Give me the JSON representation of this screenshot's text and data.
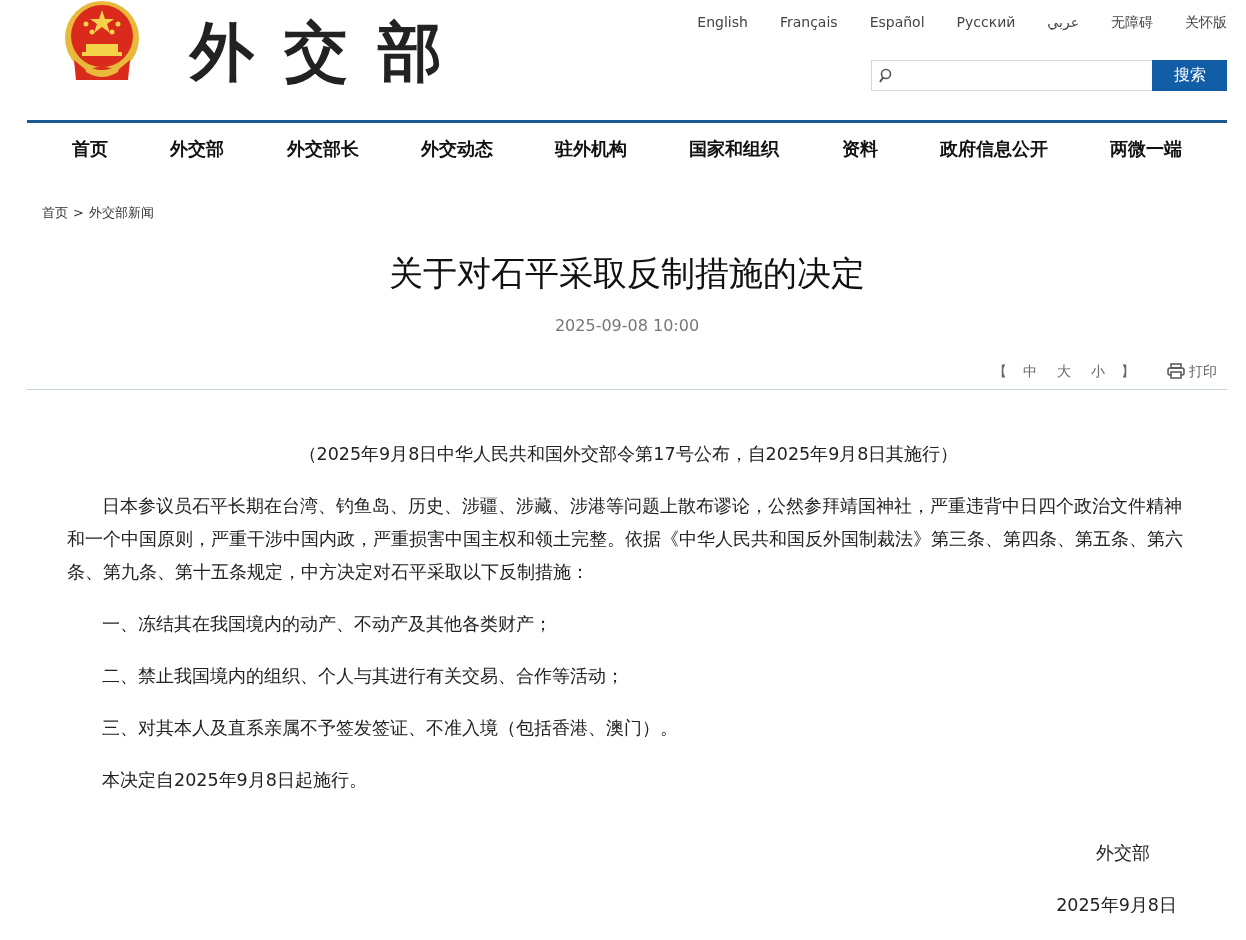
{
  "header": {
    "logo_text": "外交部",
    "languages": [
      "English",
      "Français",
      "Español",
      "Русский",
      "عربي",
      "无障碍",
      "关怀版"
    ],
    "search": {
      "button": "搜索"
    }
  },
  "nav": [
    {
      "label": "首页"
    },
    {
      "label": "外交部"
    },
    {
      "label": "外交部长"
    },
    {
      "label": "外交动态"
    },
    {
      "label": "驻外机构"
    },
    {
      "label": "国家和组织"
    },
    {
      "label": "资料"
    },
    {
      "label": "政府信息公开"
    },
    {
      "label": "两微一端"
    }
  ],
  "breadcrumb": [
    {
      "label": "首页"
    },
    {
      "label": "外交部新闻"
    }
  ],
  "breadcrumb_separator": ">",
  "article": {
    "title": "关于对石平采取反制措施的决定",
    "date": "2025-09-08 10:00",
    "tools": {
      "open": "【",
      "sizes": [
        "中",
        "大",
        "小"
      ],
      "close": "】",
      "print": "打印"
    },
    "paragraphs": [
      {
        "kind": "center",
        "text": "（2025年9月8日中华人民共和国外交部令第17号公布，自2025年9月8日其施行）"
      },
      {
        "kind": "indent",
        "text": "日本参议员石平长期在台湾、钓鱼岛、历史、涉疆、涉藏、涉港等问题上散布谬论，公然参拜靖国神社，严重违背中日四个政治文件精神和一个中国原则，严重干涉中国内政，严重损害中国主权和领土完整。依据《中华人民共和国反外国制裁法》第三条、第四条、第五条、第六条、第九条、第十五条规定，中方决定对石平采取以下反制措施："
      },
      {
        "kind": "indent",
        "text": "一、冻结其在我国境内的动产、不动产及其他各类财产；"
      },
      {
        "kind": "indent",
        "text": "二、禁止我国境内的组织、个人与其进行有关交易、合作等活动；"
      },
      {
        "kind": "indent",
        "text": "三、对其本人及直系亲属不予签发签证、不准入境（包括香港、澳门）。"
      },
      {
        "kind": "indent",
        "text": "本决定自2025年9月8日起施行。"
      },
      {
        "kind": "sign",
        "text": "外交部"
      },
      {
        "kind": "signdate",
        "text": "2025年9月8日"
      }
    ]
  }
}
